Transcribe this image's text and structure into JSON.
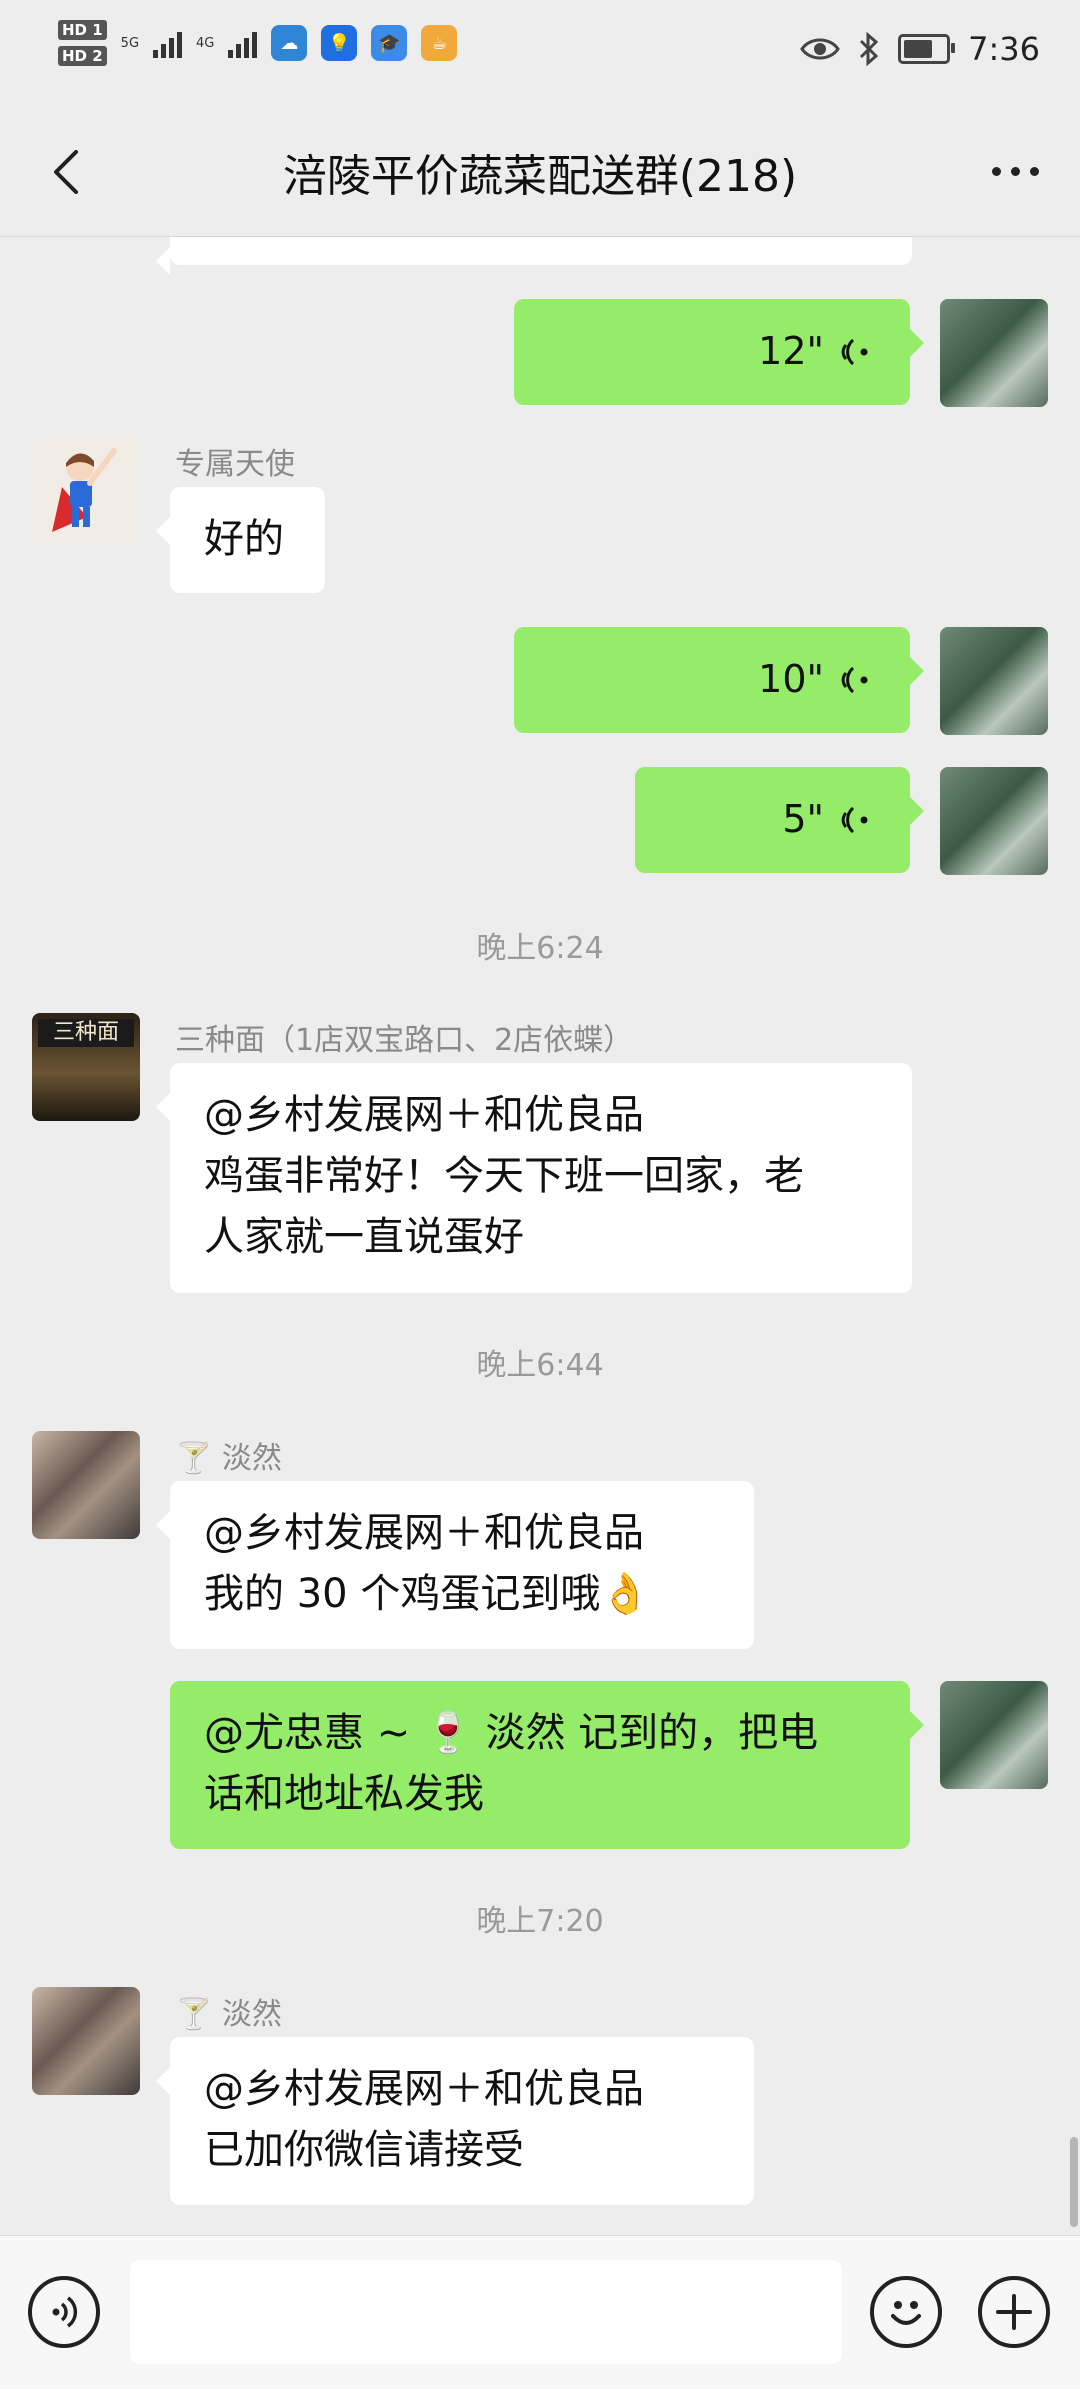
{
  "status_bar": {
    "time": "7:36",
    "sim1": "HD 1",
    "sim2": "HD 2",
    "net1": "5G",
    "net2": "4G",
    "battery_level": 0.7,
    "icons": [
      "signal-5g-icon",
      "signal-4g-icon",
      "weather-app-icon",
      "bulb-app-icon",
      "graduation-app-icon",
      "cup-app-icon",
      "eye-icon",
      "bluetooth-icon",
      "battery-icon"
    ]
  },
  "header": {
    "title": "涪陵平价蔬菜配送群(218)",
    "back_icon": "back-chevron-icon",
    "more_icon": "more-dots-icon"
  },
  "messages": [
    {
      "type": "voice",
      "side": "right",
      "duration": "12\""
    },
    {
      "type": "text",
      "side": "left",
      "sender": "专属天使",
      "text": "好的"
    },
    {
      "type": "voice",
      "side": "right",
      "duration": "10\""
    },
    {
      "type": "voice",
      "side": "right",
      "duration": "5\""
    },
    {
      "type": "timestamp",
      "text": "晚上6:24"
    },
    {
      "type": "text",
      "side": "left",
      "sender": "三种面（1店双宝路口、2店依蝶）",
      "lines": [
        "@乡村发展网＋和优良品",
        "鸡蛋非常好！今天下班一回家，老",
        "人家就一直说蛋好"
      ]
    },
    {
      "type": "timestamp",
      "text": "晚上6:44"
    },
    {
      "type": "text",
      "side": "left",
      "sender_prefix": "🍸",
      "sender": "淡然",
      "lines": [
        "@乡村发展网＋和优良品",
        "我的 30 个鸡蛋记到哦👌"
      ]
    },
    {
      "type": "text",
      "side": "right",
      "lines": [
        "@尤忠惠 ~ 🍷 淡然  记到的，把电",
        "话和地址私发我"
      ]
    },
    {
      "type": "timestamp",
      "text": "晚上7:20"
    },
    {
      "type": "text",
      "side": "left",
      "sender_prefix": "🍸",
      "sender": "淡然",
      "lines": [
        "@乡村发展网＋和优良品",
        "已加你微信请接受"
      ]
    }
  ],
  "input_bar": {
    "voice_icon": "voice-mode-icon",
    "input_value": "",
    "emoji_icon": "emoji-icon",
    "plus_icon": "plus-icon"
  },
  "colors": {
    "background": "#ededed",
    "self_bubble": "#95ec69",
    "other_bubble": "#ffffff",
    "meta_text": "#8a8a8a"
  }
}
